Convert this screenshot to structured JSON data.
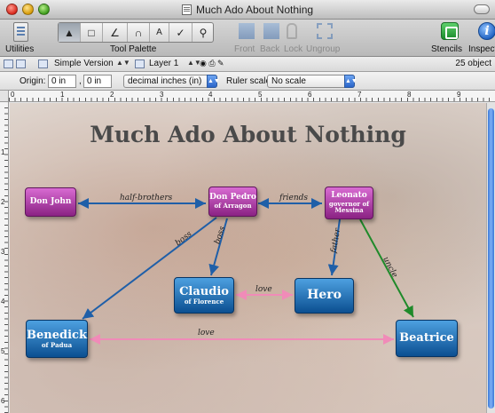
{
  "window": {
    "title": "Much Ado About Nothing"
  },
  "toolbar": {
    "utilities_label": "Utilities",
    "tool_palette_label": "Tool Palette",
    "front_label": "Front",
    "back_label": "Back",
    "lock_label": "Lock",
    "ungroup_label": "Ungroup",
    "stencils_label": "Stencils",
    "inspect_label": "Inspect"
  },
  "bar2": {
    "canvas_name": "Simple Version",
    "layer_name": "Layer 1",
    "object_count": "25 object"
  },
  "bar3": {
    "origin_label": "Origin:",
    "origin_x": "0 in",
    "origin_y": "0 in",
    "units": "decimal inches (in)",
    "ruler_scale_label": "Ruler scale:",
    "ruler_scale": "No scale"
  },
  "rulers": {
    "h_numbers": [
      "0",
      "1",
      "2",
      "3",
      "4",
      "5",
      "6",
      "7",
      "8",
      "9"
    ],
    "v_numbers": [
      "1",
      "2",
      "3",
      "4",
      "5",
      "6"
    ]
  },
  "diagram": {
    "title": "Much Ado About Nothing",
    "nodes": {
      "don_john": {
        "name": "Don John"
      },
      "don_pedro": {
        "name": "Don Pedro",
        "sub": "of Arragon"
      },
      "leonato": {
        "name": "Leonato",
        "sub1": "governor of",
        "sub2": "Messina"
      },
      "claudio": {
        "name": "Claudio",
        "sub": "of Florence"
      },
      "hero": {
        "name": "Hero"
      },
      "benedick": {
        "name": "Benedick",
        "sub": "of Padua"
      },
      "beatrice": {
        "name": "Beatrice"
      }
    },
    "links": {
      "half_brothers": "half-brothers",
      "friends": "friends",
      "boss1": "boss",
      "boss2": "boss",
      "father": "father",
      "uncle": "uncle",
      "love1": "love",
      "love2": "love"
    },
    "colors": {
      "purple_node": "#b043a8",
      "blue_node": "#1b68b0",
      "blue_link": "#1f5fa8",
      "green_link": "#1f8a2a",
      "pink_link": "#f08bb8"
    }
  }
}
